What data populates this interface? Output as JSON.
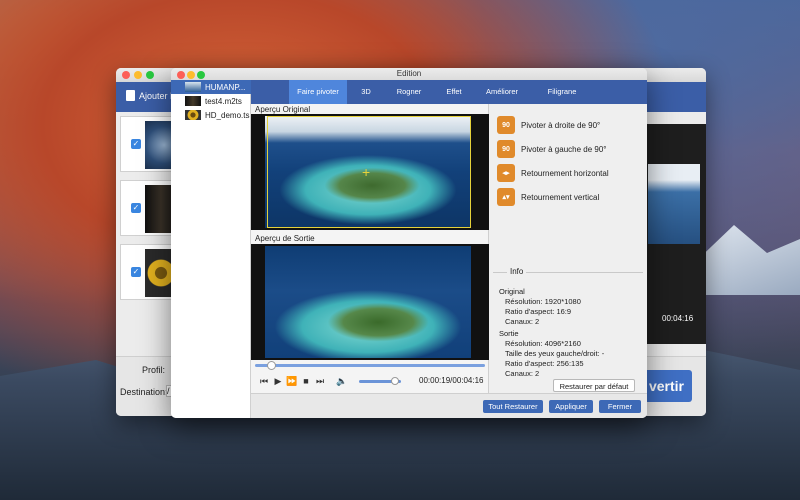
{
  "back_window": {
    "add_file_label": "Ajouter Fi",
    "profile_label": "Profil:",
    "destination_label": "Destination:",
    "destination_value": "/",
    "convert_label": "vertir",
    "preview_time": "00:04:16"
  },
  "dialog": {
    "title": "Edition",
    "files": [
      {
        "name": "HUMANP..."
      },
      {
        "name": "test4.m2ts"
      },
      {
        "name": "HD_demo.ts"
      }
    ],
    "tabs": [
      "Faire pivoter",
      "3D",
      "Rogner",
      "Effet",
      "Améliorer",
      "Filigrane"
    ],
    "active_tab": "Faire pivoter",
    "original_preview_label": "Aperçu Original",
    "output_preview_label": "Aperçu de Sortie",
    "time": "00:00:19/00:04:16",
    "playback_position": 0.07,
    "volume": 0.85,
    "rotate_options": [
      {
        "label": "Pivoter à droite de 90°",
        "icon": "rotate-right-90-icon"
      },
      {
        "label": "Pivoter à gauche de 90°",
        "icon": "rotate-left-90-icon"
      },
      {
        "label": "Retournement horizontal",
        "icon": "flip-horizontal-icon"
      },
      {
        "label": "Retournement vertical",
        "icon": "flip-vertical-icon"
      }
    ],
    "info": {
      "title": "Info",
      "original_label": "Original",
      "original_resolution": "Résolution: 1920*1080",
      "original_ratio": "Ratio d'aspect: 16:9",
      "original_channels": "Canaux: 2",
      "output_label": "Sortie",
      "output_resolution": "Résolution: 4096*2160",
      "output_eye_size": "Taille des yeux gauche/droit: -",
      "output_ratio": "Ratio d'aspect: 256:135",
      "output_channels": "Canaux: 2"
    },
    "buttons": {
      "restore_default": "Restaurer par défaut",
      "restore_all": "Tout Restaurer",
      "apply": "Appliquer",
      "close": "Fermer"
    }
  },
  "colors": {
    "accent_blue": "#3b5ea7",
    "active_tab": "#4f86dc",
    "icon_orange": "#e08a2b",
    "crop_frame": "#e6d23a"
  }
}
